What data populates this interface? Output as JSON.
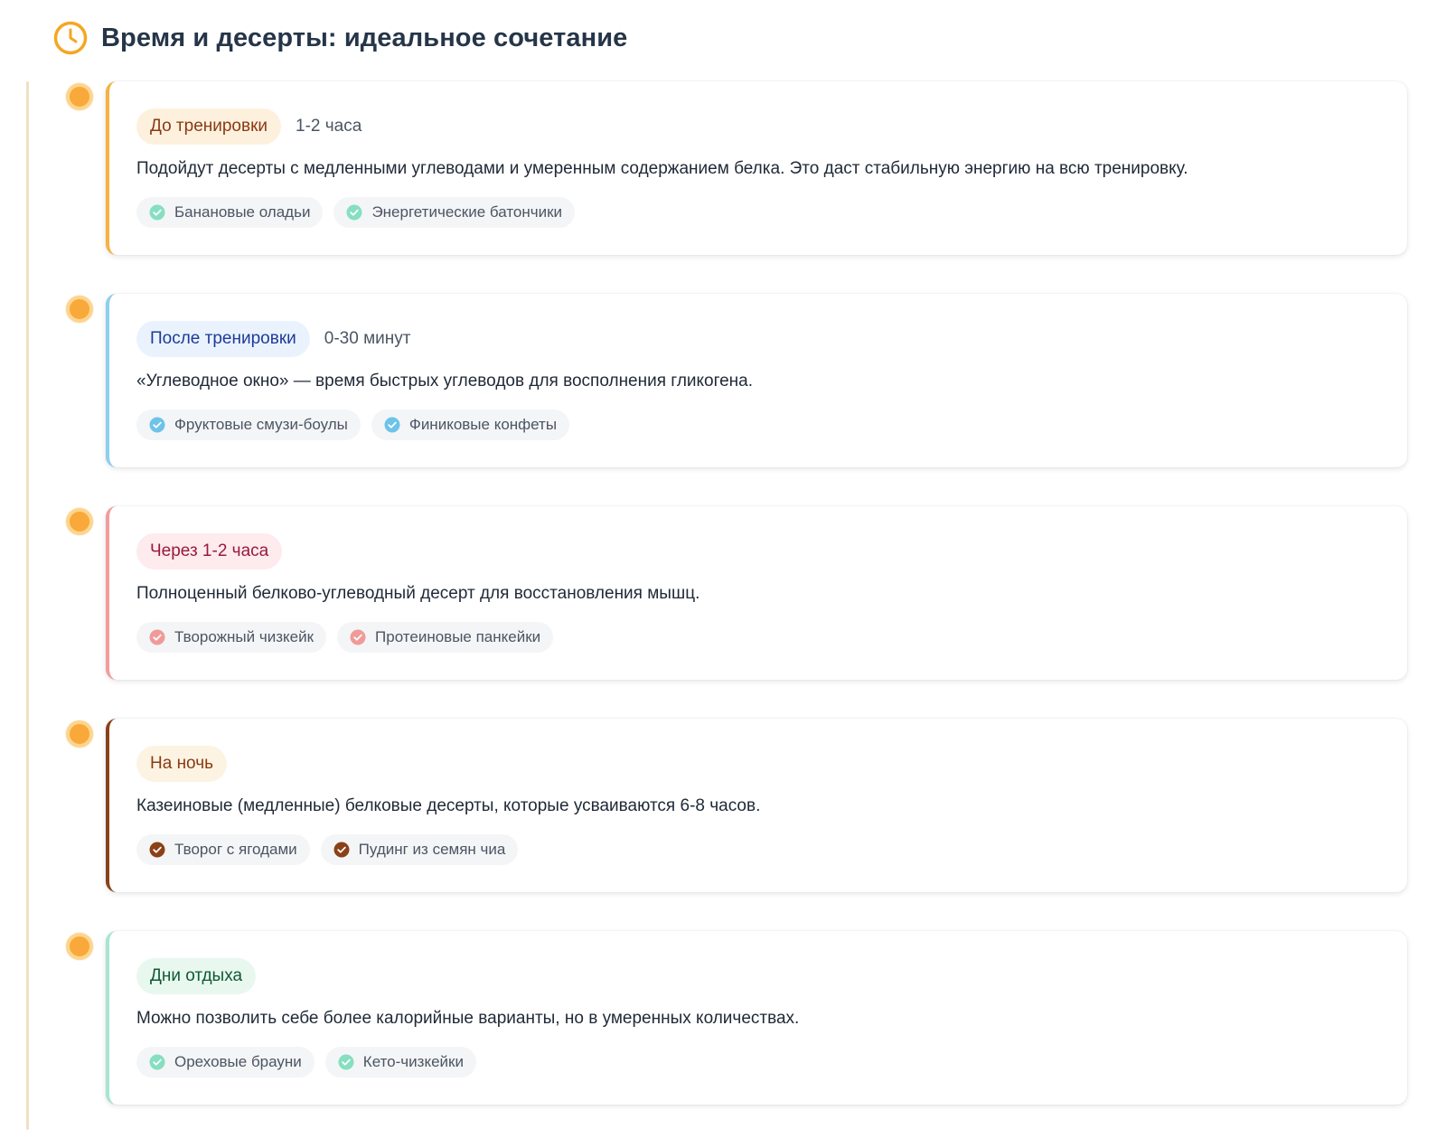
{
  "header": {
    "title": "Время и десерты: идеальное сочетание",
    "icon": "clock-icon",
    "accent": "#f5a623"
  },
  "timeline": {
    "items": [
      {
        "badge": "До тренировки",
        "timing": "1-2 часа",
        "description": "Подойдут десерты с медленными углеводами и умеренным содержанием белка. Это даст стабильную энергию на всю тренировку.",
        "tags": [
          "Банановые оладьи",
          "Энергетические батончики"
        ],
        "border_color": "#f5b342",
        "badge_bg": "#fdf1de",
        "badge_color": "#8a3a12",
        "check_color": "#86dfc0"
      },
      {
        "badge": "После тренировки",
        "timing": "0-30 минут",
        "description": "«Углеводное окно» — время быстрых углеводов для восполнения гликогена.",
        "tags": [
          "Фруктовые смузи-боулы",
          "Финиковые конфеты"
        ],
        "border_color": "#8ccfee",
        "badge_bg": "#eaf3fd",
        "badge_color": "#1e3a9a",
        "check_color": "#6ec3ea"
      },
      {
        "badge": "Через 1-2 часа",
        "timing": "",
        "description": "Полноценный белково-углеводный десерт для восстановления мышц.",
        "tags": [
          "Творожный чизкейк",
          "Протеиновые панкейки"
        ],
        "border_color": "#f39c9c",
        "badge_bg": "#fdebee",
        "badge_color": "#9a1a3a",
        "check_color": "#f19a9a"
      },
      {
        "badge": "На ночь",
        "timing": "",
        "description": "Казеиновые (медленные) белковые десерты, которые усваиваются 6-8 часов.",
        "tags": [
          "Творог с ягодами",
          "Пудинг из семян чиа"
        ],
        "border_color": "#8b4117",
        "badge_bg": "#fdf3e3",
        "badge_color": "#8a3a12",
        "check_color": "#8b4117"
      },
      {
        "badge": "Дни отдыха",
        "timing": "",
        "description": "Можно позволить себе более калорийные варианты, но в умеренных количествах.",
        "tags": [
          "Ореховые брауни",
          "Кето-чизкейки"
        ],
        "border_color": "#a7e6cf",
        "badge_bg": "#e9f8ef",
        "badge_color": "#0f5a33",
        "check_color": "#86dfc0"
      }
    ]
  }
}
